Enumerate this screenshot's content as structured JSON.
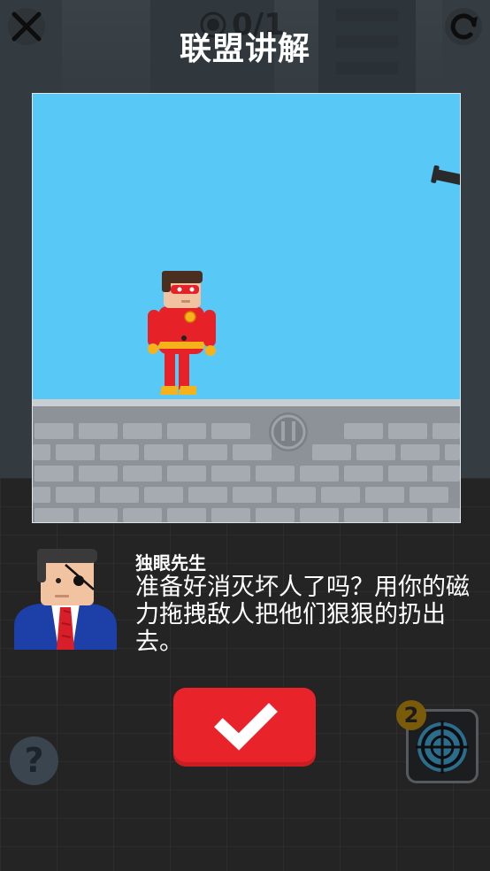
{
  "header": {
    "title": "联盟讲解",
    "counter": "0/1",
    "close_icon": "close-icon",
    "restart_icon": "restart-icon",
    "target_icon": "target-icon"
  },
  "dialog": {
    "speaker": "独眼先生",
    "text": "准备好消灭坏人了吗？用你的磁力拖拽敌人把他们狠狠的扔出去。"
  },
  "controls": {
    "confirm_icon": "checkmark-icon",
    "help_label": "?",
    "powerup_count": "2",
    "powerup_icon": "crosshair-icon"
  },
  "colors": {
    "sky": "#58c8f7",
    "confirm": "#e82329",
    "hero": "#e62228"
  }
}
